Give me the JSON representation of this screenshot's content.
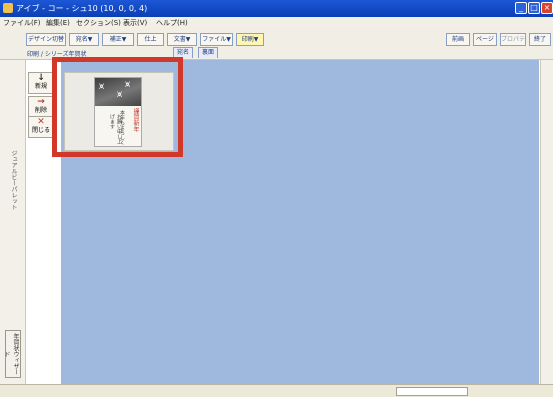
{
  "window": {
    "title": "アイブ - コー - シュ10 (10, 0, 0, 4)"
  },
  "menu": [
    "ファイル(F)",
    "編集(E)",
    "セクション(S)",
    "表示(V)",
    "ヘルプ(H)"
  ],
  "toolbar": {
    "left": [
      "デザイン切替",
      "宛名▼",
      "補正▼",
      "仕上",
      "文書▼",
      "ファイル▼",
      "印刷▼"
    ],
    "right": [
      "前画",
      "ページ",
      "プロパティ",
      "終了"
    ]
  },
  "path_text": "印刷 / シリーズ年賀状",
  "tabs": [
    "宛名",
    "裏面"
  ],
  "sidebar": {
    "new_label": "新規",
    "delete_label": "削除",
    "close_label": "閉じる",
    "palette_label": "ジュアルビーパレット",
    "wizard_label": "年賀状ウィザード"
  },
  "card": {
    "vertical_texts": [
      "謹賀新年",
      "本年もよろしく",
      "お願い申し上げます"
    ]
  },
  "colors": {
    "titlebar": "#0a3fb5",
    "canvas": "#9eb8de",
    "highlight": "#d2382a"
  }
}
